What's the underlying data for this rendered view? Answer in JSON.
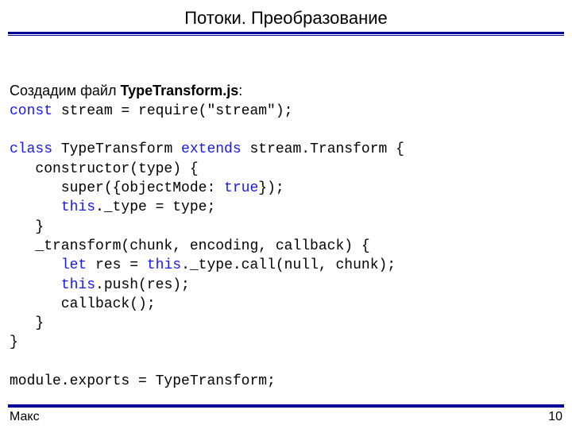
{
  "title": "Потоки. Преобразование",
  "intro_prefix": "Создадим файл ",
  "intro_filename": "TypeTransform.js",
  "intro_suffix": ":",
  "code": {
    "l1a": "const",
    "l1b": " stream = require(\"stream\");",
    "l2": "",
    "l3a": "class",
    "l3b": " TypeTransform ",
    "l3c": "extends",
    "l3d": " stream.Transform {",
    "l4": "   constructor(type) {",
    "l5a": "      super({objectMode: ",
    "l5b": "true",
    "l5c": "});",
    "l6a": "      ",
    "l6b": "this",
    "l6c": "._type = type;",
    "l7": "   }",
    "l8": "   _transform(chunk, encoding, callback) {",
    "l9a": "      ",
    "l9b": "let",
    "l9c": " res = ",
    "l9d": "this",
    "l9e": "._type.call(null, chunk);",
    "l10a": "      ",
    "l10b": "this",
    "l10c": ".push(res);",
    "l11": "      callback();",
    "l12": "   }",
    "l13": "}",
    "l14": "",
    "l15": "module.exports = TypeTransform;"
  },
  "footer": {
    "author": "Макс",
    "page": "10"
  }
}
